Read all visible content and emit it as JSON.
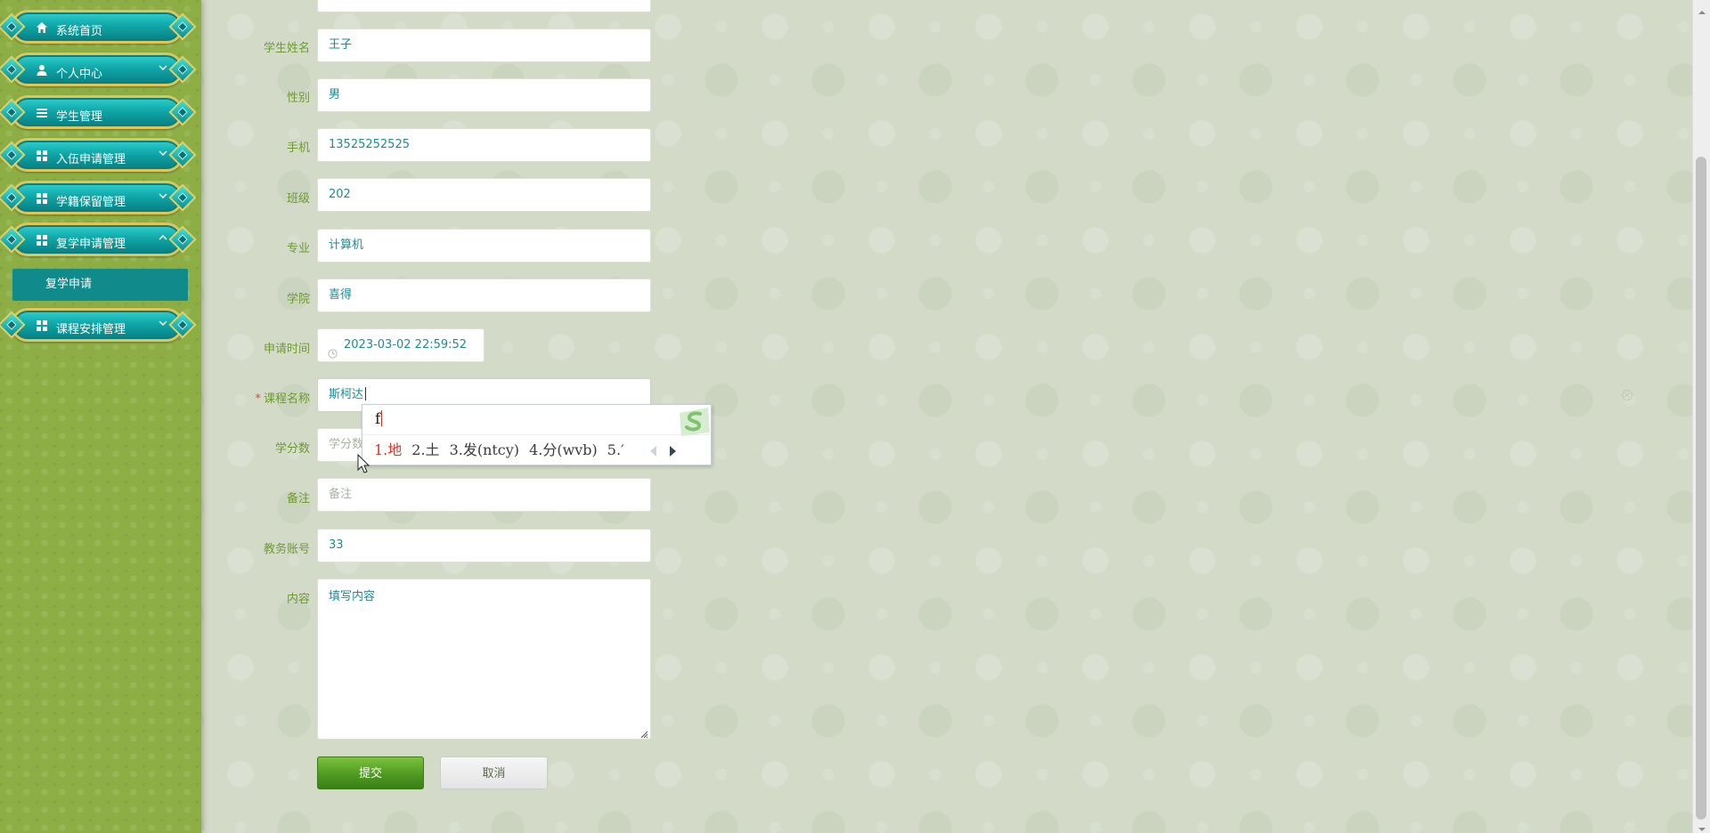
{
  "sidebar": {
    "items": [
      {
        "label": "系统首页",
        "icon": "home-icon"
      },
      {
        "label": "个人中心",
        "icon": "user-icon"
      },
      {
        "label": "学生管理",
        "icon": "list-icon"
      },
      {
        "label": "入伍申请管理",
        "icon": "grid-icon"
      },
      {
        "label": "学籍保留管理",
        "icon": "grid-icon"
      },
      {
        "label": "复学申请管理",
        "icon": "grid-icon"
      },
      {
        "label": "课程安排管理",
        "icon": "grid-icon"
      }
    ],
    "submenu": {
      "label": "复学申请"
    }
  },
  "form": {
    "student_name": {
      "label": "学生姓名",
      "value": "王子"
    },
    "gender": {
      "label": "性别",
      "value": "男"
    },
    "phone": {
      "label": "手机",
      "value": "13525252525"
    },
    "class": {
      "label": "班级",
      "value": "202"
    },
    "major": {
      "label": "专业",
      "value": "计算机"
    },
    "college": {
      "label": "学院",
      "value": "喜得"
    },
    "apply_time": {
      "label": "申请时间",
      "value": "2023-03-02 22:59:52"
    },
    "course_name": {
      "label": "课程名称",
      "required_mark": "*",
      "value": "斯柯达"
    },
    "credits": {
      "label": "学分数",
      "placeholder": "学分数"
    },
    "remark": {
      "label": "备注",
      "placeholder": "备注"
    },
    "academic_account": {
      "label": "教务账号",
      "value": "33"
    },
    "content": {
      "label": "内容",
      "value": "填写内容"
    }
  },
  "buttons": {
    "submit": "提交",
    "cancel": "取消"
  },
  "ime": {
    "input": "f",
    "candidates": [
      "1.地",
      "2.土",
      "3.发(ntcy)",
      "4.分(wvb)",
      "5.′"
    ]
  },
  "colors": {
    "sidebar_bg": "#8cae45",
    "menu_teal": "#10a7a8",
    "label_green": "#6f9a32",
    "value_teal": "#1f8a93",
    "submit_green": "#4f9a22"
  }
}
